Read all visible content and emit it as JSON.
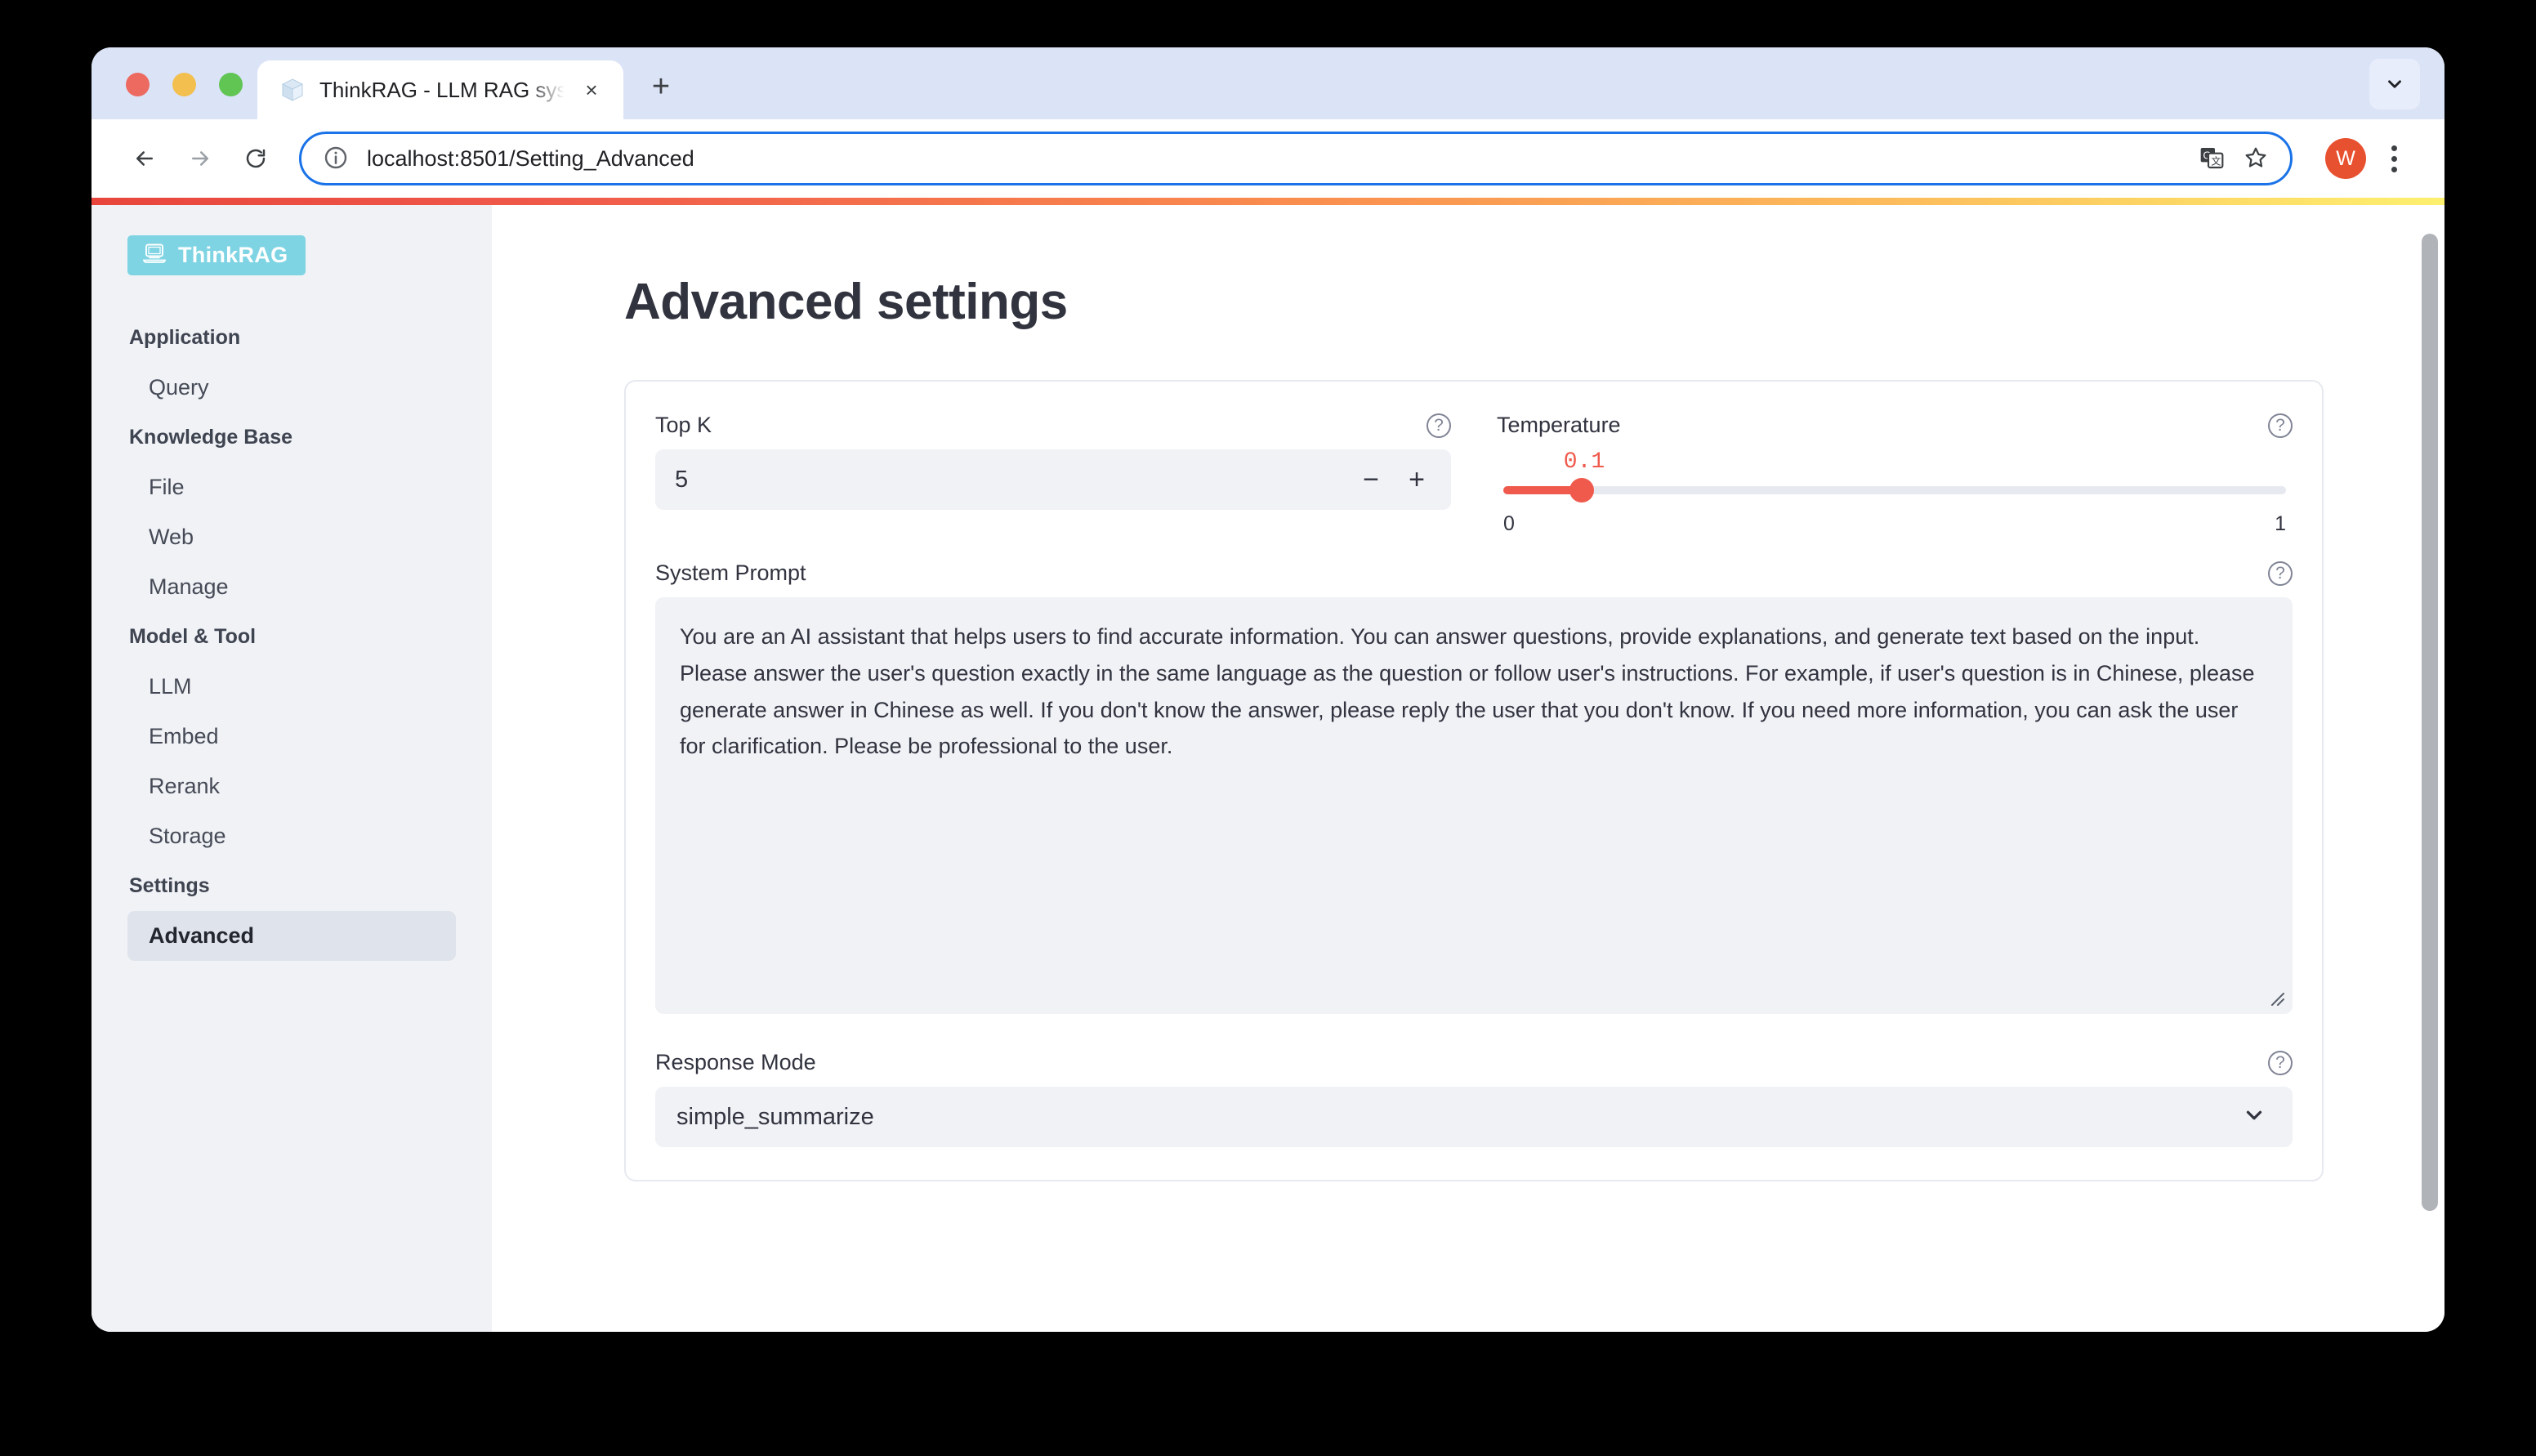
{
  "browser": {
    "tab": {
      "title": "ThinkRAG - LLM RAG system",
      "favicon": "cube-icon",
      "close": "×"
    },
    "new_tab_label": "+",
    "tab_search": "chevron-down-icon",
    "nav": {
      "back": "←",
      "forward": "→",
      "reload": "⟳"
    },
    "omnibox": {
      "url": "localhost:8501/Setting_Advanced",
      "info_icon": "info-icon",
      "translate_icon": "translate-icon",
      "bookmark_icon": "star-icon"
    },
    "profile_initial": "W",
    "menu_icon": "kebab-menu-icon"
  },
  "sidebar": {
    "logo": {
      "text": "ThinkRAG",
      "icon": "laptop-icon",
      "bg": "#7fd4e3"
    },
    "groups": [
      {
        "title": "Application",
        "items": [
          {
            "label": "Query",
            "active": false
          }
        ]
      },
      {
        "title": "Knowledge Base",
        "items": [
          {
            "label": "File",
            "active": false
          },
          {
            "label": "Web",
            "active": false
          },
          {
            "label": "Manage",
            "active": false
          }
        ]
      },
      {
        "title": "Model & Tool",
        "items": [
          {
            "label": "LLM",
            "active": false
          },
          {
            "label": "Embed",
            "active": false
          },
          {
            "label": "Rerank",
            "active": false
          },
          {
            "label": "Storage",
            "active": false
          }
        ]
      },
      {
        "title": "Settings",
        "items": [
          {
            "label": "Advanced",
            "active": true
          }
        ]
      }
    ]
  },
  "main": {
    "page_title": "Advanced settings",
    "top_k": {
      "label": "Top K",
      "value": "5",
      "decrement": "−",
      "increment": "+",
      "help_icon": "help-circle-icon"
    },
    "temperature": {
      "label": "Temperature",
      "value": "0.1",
      "min_label": "0",
      "max_label": "1",
      "percent": 10,
      "accent": "#ef5a4c",
      "help_icon": "help-circle-icon"
    },
    "system_prompt": {
      "label": "System Prompt",
      "value": "You are an AI assistant that helps users to find accurate information. You can answer questions, provide explanations, and generate text based on the input. Please answer the user's question exactly in the same language as the question or follow user's instructions. For example, if user's question is in Chinese, please generate answer in Chinese as well. If you don't know the answer, please reply the user that you don't know. If you need more information, you can ask the user for clarification. Please be professional to the user.",
      "help_icon": "help-circle-icon",
      "resize_handle": "resize-grip-icon"
    },
    "response_mode": {
      "label": "Response Mode",
      "value": "simple_summarize",
      "chevron": "chevron-down-icon",
      "help_icon": "help-circle-icon"
    }
  }
}
